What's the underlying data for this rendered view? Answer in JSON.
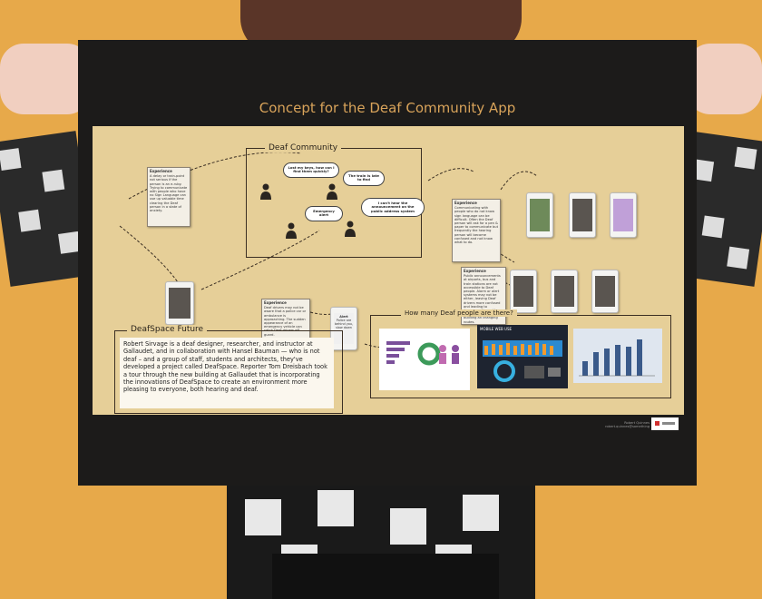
{
  "poster": {
    "title": "Concept for the Deaf Community App",
    "community_label": "Deaf Community",
    "bubbles": [
      "Lost my keys, how can I find them quickly?",
      "The train is late to find",
      "Emergency alert",
      "I can't hear the announcement on the public address system"
    ],
    "experience_label": "Experience",
    "notes": [
      "A delay or train-point not serious if the person is an e-ruby. Trying to communicate with people who have no Sign Language can use up valuable time clearing the Deaf person in a state of anxiety.",
      "Communicating with people who do not know sign language can be difficult. Often the Deaf person will ask for a pen & paper to communicate but frequently the hearing person will become confused and not know what to do.",
      "Public announcements at airports, bus and train stations are not accessible to Deaf people. Alarm or alert systems may not be either, leaving Deaf drivers more confused and leading to dangerous times. Uses, e.g. people leaving the building an changing routes.",
      "Deaf drivers may not be aware that a police car or ambulance is approaching. The sudden appearance of an emergency vehicle can catch Deaf drivers off guard."
    ],
    "alert_phone": {
      "title": "Alert",
      "text": "Police are behind you, slow down"
    },
    "future": {
      "label": "DeafSpace Future",
      "text": "Robert Sirvage is a deaf designer, researcher, and instructor at Gallaudet, and in collaboration with Hansel Bauman — who is not deaf – and a group of staff, students and architects, they've developed a project called DeafSpace. Reporter Tom Dreisbach took a tour through the new building at Gallaudet that is incorporating the innovations of DeafSpace to create an environment more pleasing to everyone, both hearing and deaf."
    },
    "stats_label": "How many Deaf people are there?",
    "chart2_title": "MOBILE WEB USE",
    "credit": [
      "Robert Quinnes",
      "robert.quinnes@something"
    ],
    "colors": {
      "background": "#e7a94a",
      "poster": "#1c1b1a",
      "panel": "#e6cf98",
      "title": "#d8a35a"
    }
  }
}
